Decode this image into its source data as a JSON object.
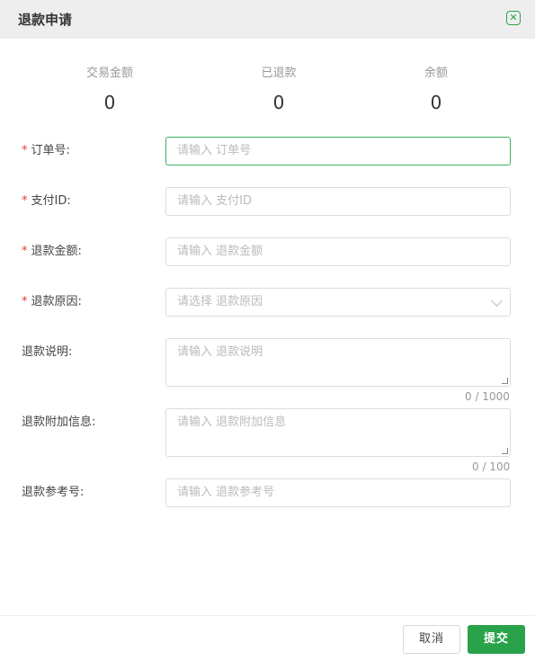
{
  "dialog": {
    "title": "退款申请"
  },
  "stats": [
    {
      "label": "交易金额",
      "value": "0"
    },
    {
      "label": "已退款",
      "value": "0"
    },
    {
      "label": "余额",
      "value": "0"
    }
  ],
  "form": {
    "required_mark": "*",
    "order_no": {
      "label": "订单号:",
      "placeholder": "请输入 订单号"
    },
    "pay_id": {
      "label": "支付ID:",
      "placeholder": "请输入 支付ID"
    },
    "refund_amount": {
      "label": "退款金额:",
      "placeholder": "请输入 退款金额"
    },
    "refund_reason": {
      "label": "退款原因:",
      "placeholder": "请选择 退款原因"
    },
    "refund_desc": {
      "label": "退款说明:",
      "placeholder": "请输入 退款说明",
      "counter": "0 / 1000"
    },
    "refund_extra": {
      "label": "退款附加信息:",
      "placeholder": "请输入 退款附加信息",
      "counter": "0 / 100"
    },
    "refund_ref": {
      "label": "退款参考号:",
      "placeholder": "请输入 退款参考号"
    }
  },
  "footer": {
    "cancel_label": "取消",
    "submit_label": "提交"
  },
  "colors": {
    "accent": "#2aa24a",
    "required": "#e53935",
    "header_bg": "#eeeeee"
  }
}
